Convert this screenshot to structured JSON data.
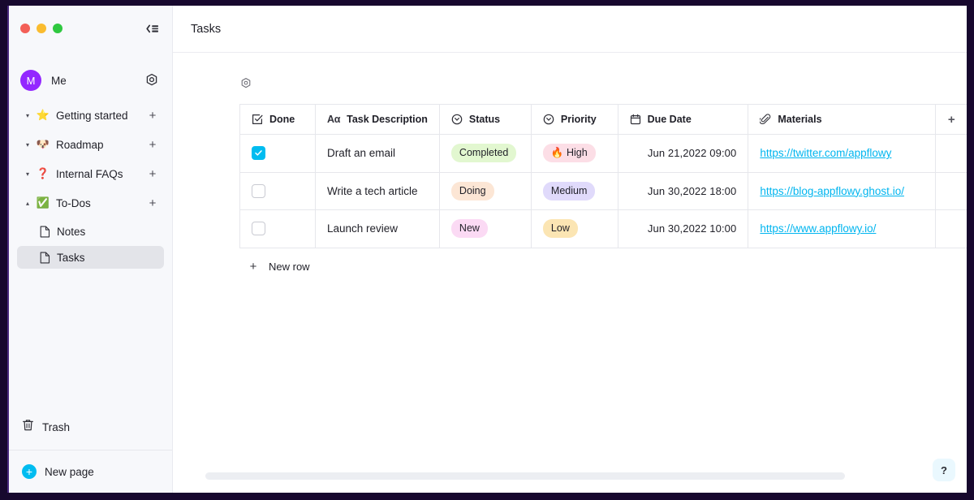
{
  "window": {
    "traffic_lights": [
      "close",
      "minimize",
      "maximize"
    ],
    "collapse_icon": "collapse-sidebar-icon",
    "border_color": "#17082e"
  },
  "sidebar": {
    "user": {
      "avatar_initial": "M",
      "name": "Me",
      "settings_icon": "settings-gear-icon",
      "avatar_color": "#9327ff"
    },
    "items": [
      {
        "emoji": "⭐",
        "label": "Getting started",
        "expanded": true,
        "caret": "▾",
        "add": "+"
      },
      {
        "emoji": "🐶",
        "label": "Roadmap",
        "expanded": true,
        "caret": "▾",
        "add": "+"
      },
      {
        "emoji": "❓",
        "label": "Internal FAQs",
        "expanded": true,
        "caret": "▾",
        "add": "+"
      },
      {
        "emoji": "✅",
        "label": "To-Dos",
        "expanded": false,
        "caret": "▴",
        "add": "+"
      }
    ],
    "children": [
      {
        "label": "Notes",
        "active": false
      },
      {
        "label": "Tasks",
        "active": true
      }
    ],
    "trash": {
      "label": "Trash",
      "icon": "trash-icon"
    },
    "new_page": {
      "label": "New page",
      "icon": "plus-circle-icon",
      "color": "#00bcf0"
    }
  },
  "topbar": {
    "title": "Tasks"
  },
  "grid_settings_icon": "grid-settings-icon",
  "table": {
    "columns": [
      {
        "label": "Done",
        "icon": "checkbox-field-icon",
        "type": "checkbox"
      },
      {
        "label": "Task Description",
        "icon": "text-field-icon",
        "type": "text"
      },
      {
        "label": "Status",
        "icon": "single-select-icon",
        "type": "select"
      },
      {
        "label": "Priority",
        "icon": "single-select-icon",
        "type": "select"
      },
      {
        "label": "Due Date",
        "icon": "calendar-icon",
        "type": "date"
      },
      {
        "label": "Materials",
        "icon": "paperclip-icon",
        "type": "url"
      }
    ],
    "add_column_label": "+",
    "rows": [
      {
        "done": true,
        "description": "Draft an email",
        "status": {
          "text": "Completed",
          "bg": "#e2f7d0"
        },
        "priority": {
          "text": "🔥 High",
          "bg": "#fcdee6"
        },
        "due_date": "Jun 21,2022  09:00",
        "material": "https://twitter.com/appflowy"
      },
      {
        "done": false,
        "description": "Write a tech article",
        "status": {
          "text": "Doing",
          "bg": "#fce6d5"
        },
        "priority": {
          "text": "Medium",
          "bg": "#e0dafb"
        },
        "due_date": "Jun 30,2022  18:00",
        "material": "https://blog-appflowy.ghost.io/"
      },
      {
        "done": false,
        "description": "Launch review",
        "status": {
          "text": "New",
          "bg": "#fbdaf4"
        },
        "priority": {
          "text": "Low",
          "bg": "#fbe5b3"
        },
        "due_date": "Jun 30,2022  10:00",
        "material": "https://www.appflowy.io/"
      }
    ],
    "new_row": {
      "plus": "+",
      "label": "New row"
    }
  },
  "help_button": {
    "label": "?"
  }
}
